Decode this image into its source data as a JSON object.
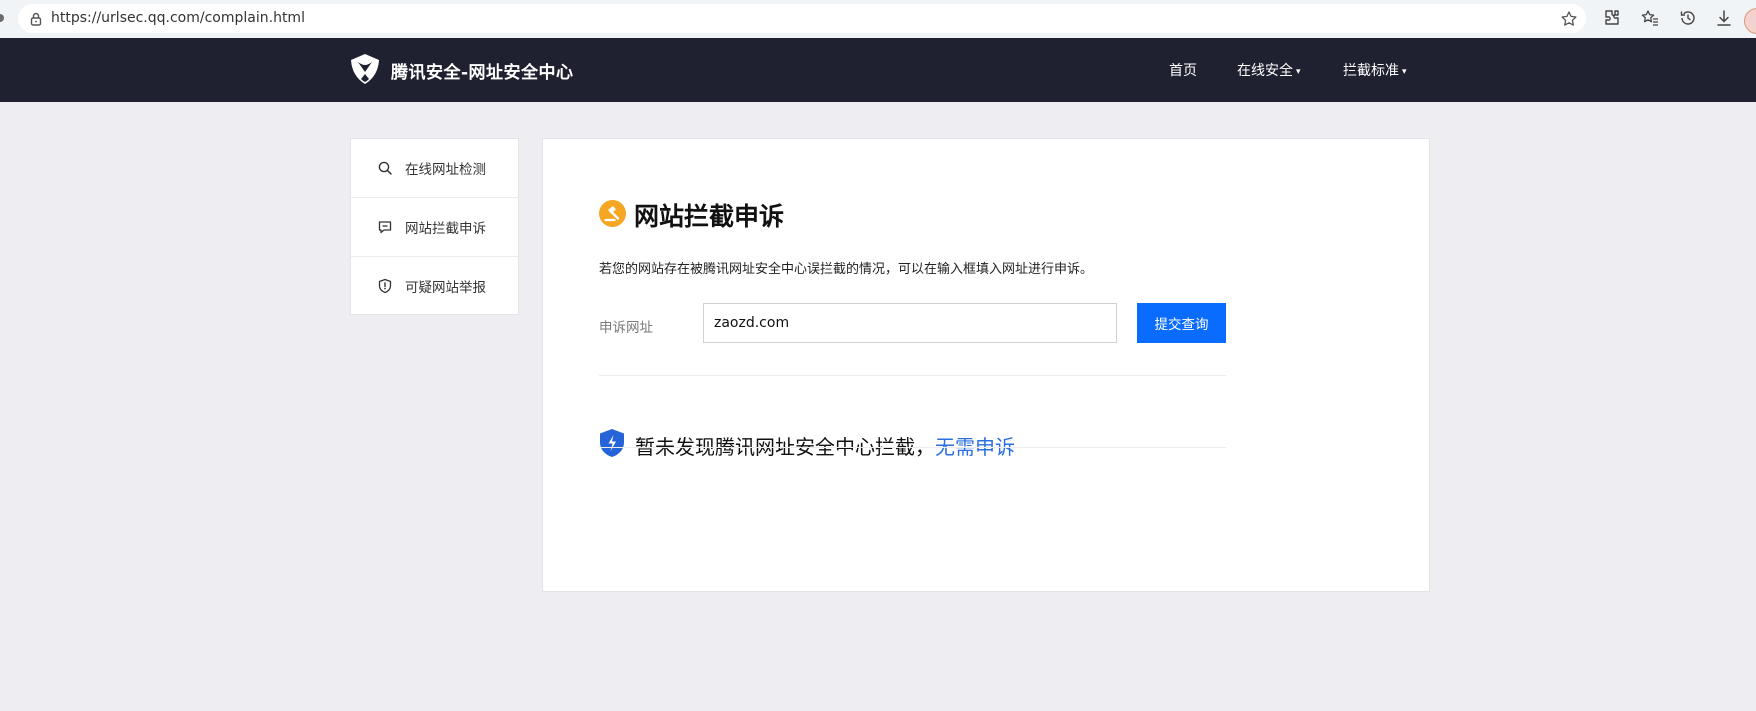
{
  "browser": {
    "url": "https://urlsec.qq.com/complain.html"
  },
  "site": {
    "brand": "腾讯安全-网址安全中心",
    "nav": [
      {
        "label": "首页",
        "has_dropdown": false
      },
      {
        "label": "在线安全",
        "has_dropdown": true
      },
      {
        "label": "拦截标准",
        "has_dropdown": true
      }
    ],
    "dropdown_caret": "▾"
  },
  "sidebar": {
    "items": [
      {
        "label": "在线网址检测",
        "icon": "search-icon"
      },
      {
        "label": "网站拦截申诉",
        "icon": "comment-icon"
      },
      {
        "label": "可疑网站举报",
        "icon": "shield-alert-icon"
      }
    ]
  },
  "main": {
    "title": "网站拦截申诉",
    "description": "若您的网站存在被腾讯网址安全中心误拦截的情况，可以在输入框填入网址进行申诉。",
    "field_label": "申诉网址",
    "input_value": "zaozd.com",
    "submit_label": "提交查询",
    "result_text": "暂未发现腾讯网址安全中心拦截，",
    "result_link": "无需申诉"
  },
  "colors": {
    "nav_bg": "#1f2130",
    "page_bg": "#eeeef2",
    "accent": "#0a6cff",
    "link": "#2a6fe0",
    "title_icon": "#f5a623",
    "shield": "#2563d9"
  }
}
